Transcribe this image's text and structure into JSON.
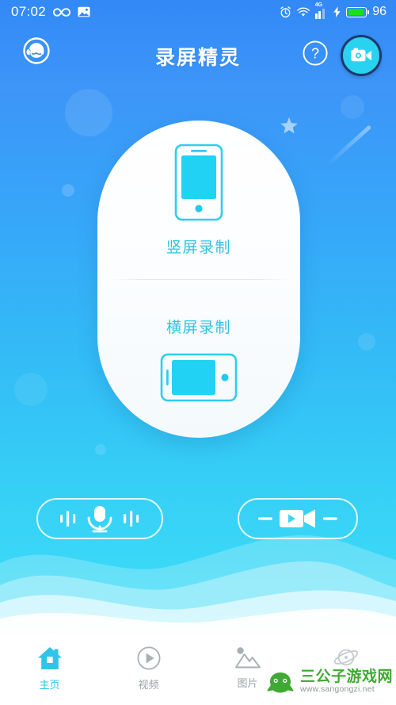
{
  "status_bar": {
    "time": "07:02",
    "battery_percent": "96",
    "network_label": "4G",
    "icons": [
      "infinity-icon",
      "image-icon",
      "alarm-icon",
      "wifi-icon",
      "signal-icon",
      "charging-bolt-icon",
      "battery-icon"
    ]
  },
  "header": {
    "title": "录屏精灵",
    "support_icon": "headset-support-icon",
    "help_icon": "question-mark-icon",
    "record_icon": "video-camera-icon"
  },
  "record_card": {
    "portrait": {
      "label": "竖屏录制",
      "icon": "phone-portrait-icon"
    },
    "landscape": {
      "label": "横屏录制",
      "icon": "phone-landscape-icon"
    }
  },
  "actions": [
    {
      "name": "audio-record",
      "icon": "microphone-icon"
    },
    {
      "name": "video-record",
      "icon": "video-camera-play-icon"
    }
  ],
  "bottom_nav": [
    {
      "label": "主页",
      "icon": "home-icon",
      "active": true
    },
    {
      "label": "视频",
      "icon": "play-circle-icon",
      "active": false
    },
    {
      "label": "图片",
      "icon": "picture-mountain-icon",
      "active": false
    },
    {
      "label": "",
      "icon": "planet-discover-icon",
      "active": false
    }
  ],
  "watermark": {
    "site_name": "三公子游戏网",
    "url": "www.sangongzi.net",
    "logo": "green-frog-logo"
  },
  "colors": {
    "accent_cyan": "#2ec5e8",
    "label_cyan": "#31c3e0",
    "bg_top_blue": "#3289f7",
    "bg_bottom_cyan": "#45e0f7",
    "battery_green": "#19e015",
    "watermark_green": "#3faa33"
  }
}
